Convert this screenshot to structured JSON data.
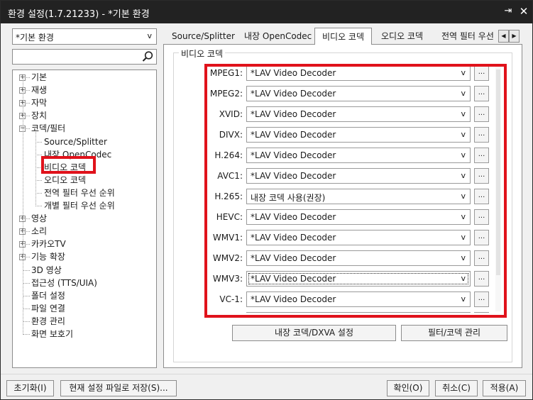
{
  "window": {
    "title": "환경 설정(1.7.21233) - *기본 환경",
    "pin": "⇥",
    "close": "✕"
  },
  "preset": {
    "value": "*기본 환경",
    "arrow": "v"
  },
  "search": {
    "placeholder": "",
    "value": ""
  },
  "tree": {
    "items": [
      {
        "label": "기본",
        "expander": "+"
      },
      {
        "label": "재생",
        "expander": "+"
      },
      {
        "label": "자막",
        "expander": "+"
      },
      {
        "label": "장치",
        "expander": "+"
      },
      {
        "label": "코덱/필터",
        "expander": "−"
      },
      {
        "label": "Source/Splitter"
      },
      {
        "label": "내장 OpenCodec"
      },
      {
        "label": "비디오 코덱"
      },
      {
        "label": "오디오 코덱"
      },
      {
        "label": "전역 필터 우선 순위"
      },
      {
        "label": "개별 필터 우선 순위"
      },
      {
        "label": "영상",
        "expander": "+"
      },
      {
        "label": "소리",
        "expander": "+"
      },
      {
        "label": "카카오TV",
        "expander": "+"
      },
      {
        "label": "기능 확장",
        "expander": "+"
      },
      {
        "label": "3D 영상"
      },
      {
        "label": "접근성 (TTS/UIA)"
      },
      {
        "label": "폴더 설정"
      },
      {
        "label": "파일 연결"
      },
      {
        "label": "환경 관리"
      },
      {
        "label": "화면 보호기"
      }
    ]
  },
  "tabs": [
    {
      "label": "Source/Splitter"
    },
    {
      "label": "내장 OpenCodec"
    },
    {
      "label": "비디오 코덱"
    },
    {
      "label": "오디오 코덱"
    },
    {
      "label": "전역 필터 우선"
    }
  ],
  "tab_nav": {
    "prev": "◀",
    "next": "▶"
  },
  "group": {
    "title": "비디오 코덱"
  },
  "codecs": [
    {
      "label": "MPEG1:",
      "value": "*LAV Video Decoder"
    },
    {
      "label": "MPEG2:",
      "value": "*LAV Video Decoder"
    },
    {
      "label": "XVID:",
      "value": "*LAV Video Decoder"
    },
    {
      "label": "DIVX:",
      "value": "*LAV Video Decoder"
    },
    {
      "label": "H.264:",
      "value": "*LAV Video Decoder"
    },
    {
      "label": "AVC1:",
      "value": "*LAV Video Decoder"
    },
    {
      "label": "H.265:",
      "value": "내장 코덱 사용(권장)"
    },
    {
      "label": "HEVC:",
      "value": "*LAV Video Decoder"
    },
    {
      "label": "WMV1:",
      "value": "*LAV Video Decoder"
    },
    {
      "label": "WMV2:",
      "value": "*LAV Video Decoder"
    },
    {
      "label": "WMV3:",
      "value": "*LAV Video Decoder"
    },
    {
      "label": "VC-1:",
      "value": "*LAV Video Decoder"
    },
    {
      "label": "",
      "value": ""
    }
  ],
  "select_arrow": "v",
  "more_button": "...",
  "panel_buttons": {
    "builtin": "내장 코덱/DXVA 설정",
    "filters": "필터/코덱 관리"
  },
  "footer": {
    "reset": "초기화(I)",
    "save": "현재 설정 파일로 저장(S)...",
    "ok": "확인(O)",
    "cancel": "취소(C)",
    "apply": "적용(A)"
  },
  "colors": {
    "highlight": "#e0121b",
    "titlebar": "#222222"
  }
}
